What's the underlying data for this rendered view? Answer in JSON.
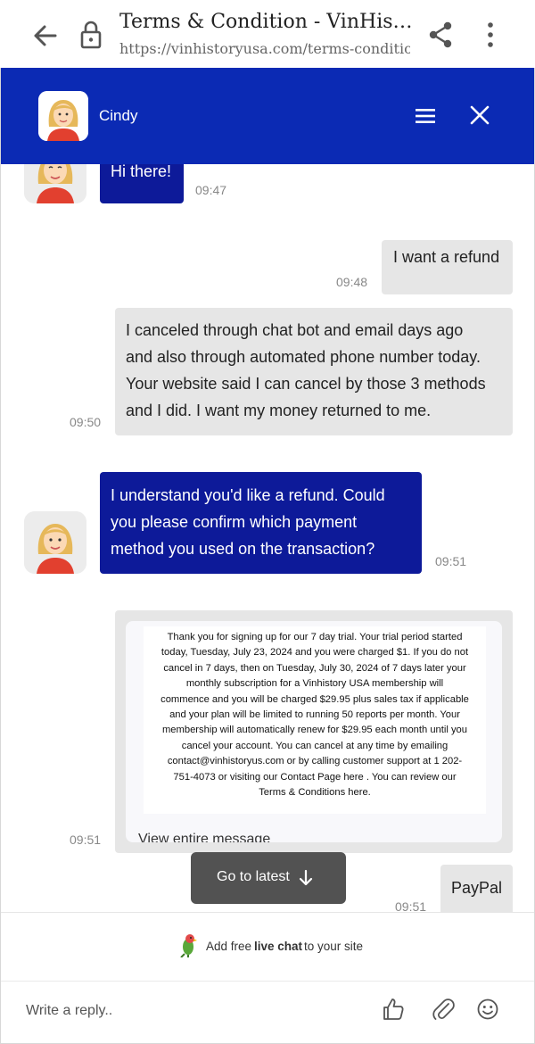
{
  "browser": {
    "title": "Terms & Condition - VinHistoryUS...",
    "url": "https://vinhistoryusa.com/terms-condition/#"
  },
  "chat": {
    "agent_name": "Cindy",
    "messages": [
      {
        "from": "bot",
        "text": "Hi there!",
        "time": "09:47"
      },
      {
        "from": "user",
        "text": "I want a refund",
        "time": "09:48"
      },
      {
        "from": "user",
        "lines": [
          "I canceled through chat bot and email days ago",
          "and also through automated phone number today.",
          "Your website said I can cancel by those 3 methods",
          "and I did. I want my money returned to me."
        ],
        "time": "09:50"
      },
      {
        "from": "bot",
        "lines": [
          "I understand you'd like a refund. Could",
          "you please confirm which payment",
          "method you used on the transaction?"
        ],
        "time": "09:51"
      },
      {
        "from": "user",
        "type": "email",
        "time": "09:51"
      },
      {
        "from": "user",
        "text": "PayPal",
        "time": "09:51"
      }
    ],
    "email": {
      "lines": [
        "Thank you for signing up for our 7 day trial. Your trial period started",
        "today, Tuesday, July 23, 2024 and you were charged $1. If you do not",
        "cancel in 7 days, then on Tuesday, July 30, 2024 of 7 days later your",
        "monthly subscription for a Vinhistory USA membership will",
        "commence and you will be charged $29.95 plus sales tax if applicable",
        "and your plan will be limited to running 50 reports per month. Your",
        "membership will automatically renew for $29.95 each month until you",
        "cancel your account. You can cancel at any time by emailing",
        "contact@vinhistoryus.com or by calling customer support at 1 202-",
        "751-4073 or visiting our Contact Page here . You can review our",
        "Terms & Conditions here."
      ],
      "view_entire": "View entire message"
    },
    "go_latest": "Go to latest",
    "promo": {
      "prefix": "Add free",
      "bold": "live chat",
      "suffix": "to your site"
    },
    "reply_placeholder": "Write a reply..",
    "colors": {
      "header": "#0b2ab4",
      "bot_bubble": "#0d1a99",
      "user_bubble": "#e6e6e6"
    }
  }
}
